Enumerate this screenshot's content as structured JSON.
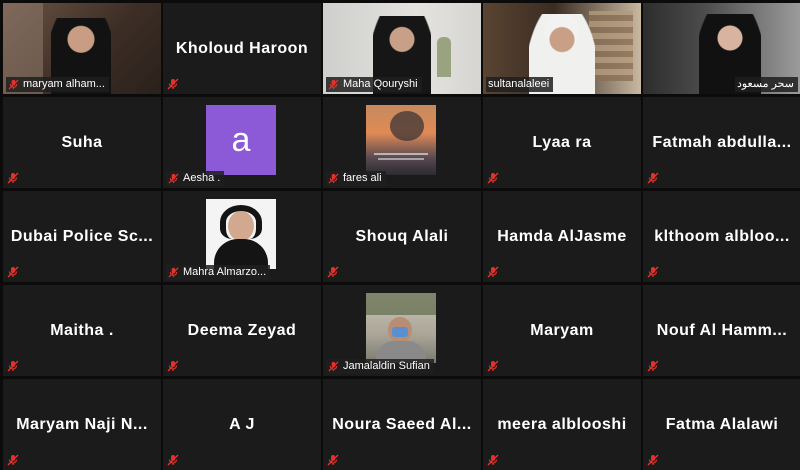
{
  "tiles": [
    {
      "name": "maryam alham...",
      "type": "video"
    },
    {
      "name": "Kholoud Haroon",
      "type": "name"
    },
    {
      "name": "Maha Qouryshi",
      "type": "video"
    },
    {
      "name": "sultanalaleei",
      "type": "video",
      "active": true
    },
    {
      "name": "سحر مسعود",
      "type": "video"
    },
    {
      "name": "Suha",
      "type": "name"
    },
    {
      "name": "Aesha .",
      "type": "avatar",
      "avatar_letter": "a"
    },
    {
      "name": "fares ali",
      "type": "image"
    },
    {
      "name": "Lyaa ra",
      "type": "name"
    },
    {
      "name": "Fatmah abdulla...",
      "type": "name"
    },
    {
      "name": "Dubai Police Sc...",
      "type": "name"
    },
    {
      "name": "Mahra Almarzo...",
      "type": "photo"
    },
    {
      "name": "Shouq Alali",
      "type": "name"
    },
    {
      "name": "Hamda AlJasme",
      "type": "name"
    },
    {
      "name": "klthoom alblоо...",
      "type": "name"
    },
    {
      "name": "Maitha .",
      "type": "name"
    },
    {
      "name": "Deema Zeyad",
      "type": "name"
    },
    {
      "name": "Jamalaldin Sufian",
      "type": "photo"
    },
    {
      "name": "Maryam",
      "type": "name"
    },
    {
      "name": "Nouf Al Hamm...",
      "type": "name"
    },
    {
      "name": "Maryam Naji N...",
      "type": "name"
    },
    {
      "name": "A J",
      "type": "name"
    },
    {
      "name": "Noura Saeed Al...",
      "type": "name"
    },
    {
      "name": "meera alblooshi",
      "type": "name"
    },
    {
      "name": "Fatma Alalawi",
      "type": "name"
    }
  ],
  "colors": {
    "active_border": "#a9d64a",
    "muted_icon": "#e0332b",
    "avatar_bg": "#8c5ad6"
  },
  "icons": {
    "muted": "mic-muted-icon"
  }
}
